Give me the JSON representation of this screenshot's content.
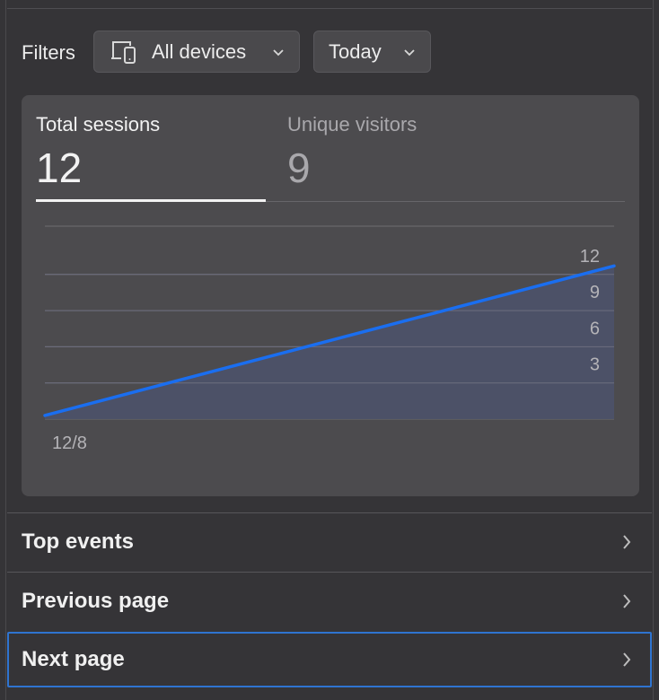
{
  "filters": {
    "label": "Filters",
    "device_dropdown": {
      "value": "All devices",
      "icon": "devices-icon"
    },
    "date_dropdown": {
      "value": "Today"
    }
  },
  "metrics": [
    {
      "label": "Total sessions",
      "value": "12",
      "selected": true
    },
    {
      "label": "Unique visitors",
      "value": "9",
      "selected": false
    }
  ],
  "chart_data": {
    "type": "area",
    "x": [
      "12/8",
      ""
    ],
    "series": [
      {
        "values": [
          0.3,
          12.7
        ]
      }
    ],
    "ylim": [
      0,
      16
    ],
    "yticks": [
      3,
      6,
      9,
      12
    ],
    "ytick_labels": [
      "3",
      "6",
      "9",
      "12"
    ],
    "xtick_labels": [
      "12/8"
    ],
    "grid": true,
    "colors": {
      "line": "#1a6ef0",
      "fill": "#4c5168"
    }
  },
  "rows": [
    {
      "label": "Top events"
    },
    {
      "label": "Previous page"
    },
    {
      "label": "Next page"
    }
  ],
  "colors": {
    "accent": "#1a6ef0",
    "focus_border": "#2f74d0"
  }
}
